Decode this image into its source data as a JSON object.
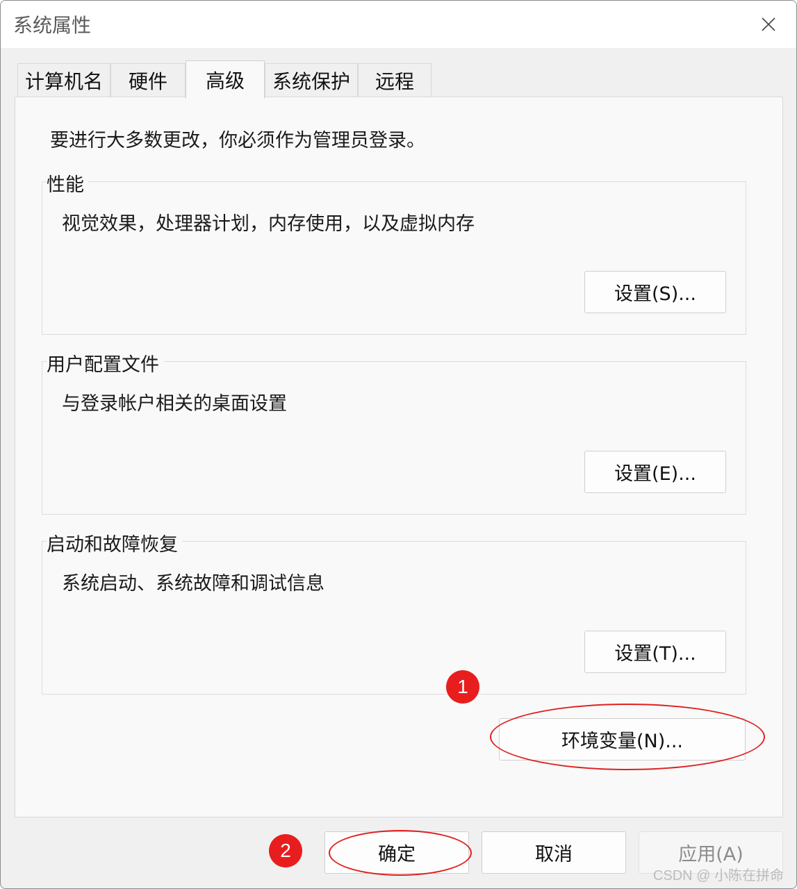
{
  "window": {
    "title": "系统属性"
  },
  "tabs": [
    {
      "label": "计算机名",
      "active": false
    },
    {
      "label": "硬件",
      "active": false
    },
    {
      "label": "高级",
      "active": true
    },
    {
      "label": "系统保护",
      "active": false
    },
    {
      "label": "远程",
      "active": false
    }
  ],
  "advanced": {
    "notice": "要进行大多数更改，你必须作为管理员登录。",
    "performance": {
      "title": "性能",
      "description": "视觉效果，处理器计划，内存使用，以及虚拟内存",
      "button": "设置(S)..."
    },
    "user_profiles": {
      "title": "用户配置文件",
      "description": "与登录帐户相关的桌面设置",
      "button": "设置(E)..."
    },
    "startup_recovery": {
      "title": "启动和故障恢复",
      "description": "系统启动、系统故障和调试信息",
      "button": "设置(T)..."
    },
    "env_button": "环境变量(N)..."
  },
  "footer": {
    "ok": "确定",
    "cancel": "取消",
    "apply": "应用(A)"
  },
  "annotations": {
    "marker1": "1",
    "marker2": "2",
    "color": "#e81e1e"
  },
  "watermark": "CSDN @ 小陈在拼命"
}
